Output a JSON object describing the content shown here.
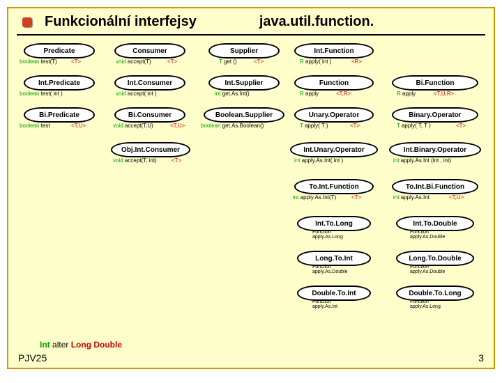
{
  "header": {
    "title_left": "Funkcionální  interfejsy",
    "title_right": "java.util.function."
  },
  "row1": {
    "c1": {
      "name": "Predicate",
      "ret": "boolean",
      "m": "test(T)",
      "g": "<T>"
    },
    "c2": {
      "name": "Consumer",
      "ret": "void",
      "m": "accept(T)",
      "g": "<T>"
    },
    "c3": {
      "name": "Supplier",
      "ret": "T",
      "m": "get ()",
      "g": "<T>"
    },
    "c4": {
      "name": "Int.Function",
      "ret": "R",
      "m": "apply( int )",
      "g": "<R>"
    }
  },
  "row2": {
    "c1": {
      "name": "Int.Predicate",
      "ret": "boolean",
      "m": "test( int )"
    },
    "c2": {
      "name": "Int.Consumer",
      "ret": "void",
      "m": "accept( int )"
    },
    "c3": {
      "name": "Int.Supplier",
      "ret": "int",
      "m": "get.As.Int()"
    },
    "c4": {
      "name": "Function",
      "ret": "R",
      "m": "apply",
      "g": "<T,R>"
    },
    "c5": {
      "name": "Bi.Function",
      "ret": "R",
      "m": "apply",
      "g": "<T,U,R>"
    }
  },
  "row3": {
    "c1": {
      "name": "Bi.Predicate",
      "ret": "boolean",
      "m": "test",
      "g": "<T,U>"
    },
    "c2": {
      "name": "Bi.Consumer",
      "ret": "void",
      "m": "accept(T,U)",
      "g": "<T,U>"
    },
    "c3": {
      "name": "Boolean.Supplier",
      "ret": "boolean",
      "m": "get.As.Boolean()"
    },
    "c4": {
      "name": "Unary.Operator",
      "ret": "T",
      "m": "apply( T )",
      "g": "<T>"
    },
    "c5": {
      "name": "Binary.Operator",
      "ret": "T",
      "m": "apply( T, T )",
      "g": "<T>"
    }
  },
  "row4": {
    "c2": {
      "name": "Obj.Int.Consumer",
      "ret": "void",
      "m": "accept(T, int)",
      "g": "<T>"
    },
    "c4": {
      "name": "Int.Unary.Operator",
      "ret": "int",
      "m": "apply.As.Int( int )"
    },
    "c5": {
      "name": "Int.Binary.Operator",
      "ret": "int",
      "m": "apply.As.Int (int , int)"
    }
  },
  "row5": {
    "c4": {
      "name": "To.Int.Function",
      "ret": "int",
      "m": "apply.As.Int(T)",
      "g": "<T>"
    },
    "c5": {
      "name": "To.Int.Bi.Function",
      "ret": "int",
      "m": "apply.As.Int",
      "g": "<T,U>"
    }
  },
  "row6": {
    "c4": {
      "name": "Int.To.Long",
      "sub": "Function",
      "m": "apply.As.Long"
    },
    "c5": {
      "name": "Int.To.Double",
      "sub": "Function",
      "m": "apply.As.Double"
    }
  },
  "row7": {
    "c4": {
      "name": "Long.To.Int",
      "sub": "Function",
      "m": "apply.As.Double"
    },
    "c5": {
      "name": "Long.To.Double",
      "sub": "Function",
      "m": "apply.As.Double"
    }
  },
  "row8": {
    "c4": {
      "name": "Double.To.Int",
      "sub": "Function",
      "m": "apply.As.Int"
    },
    "c5": {
      "name": "Double.To.Long",
      "sub": "Function",
      "m": "apply.As.Long"
    }
  },
  "legend": {
    "k1": "Int",
    "k2": "alter",
    "k3": "Long  Double"
  },
  "footer": {
    "label": "PJV25",
    "page": "3"
  }
}
